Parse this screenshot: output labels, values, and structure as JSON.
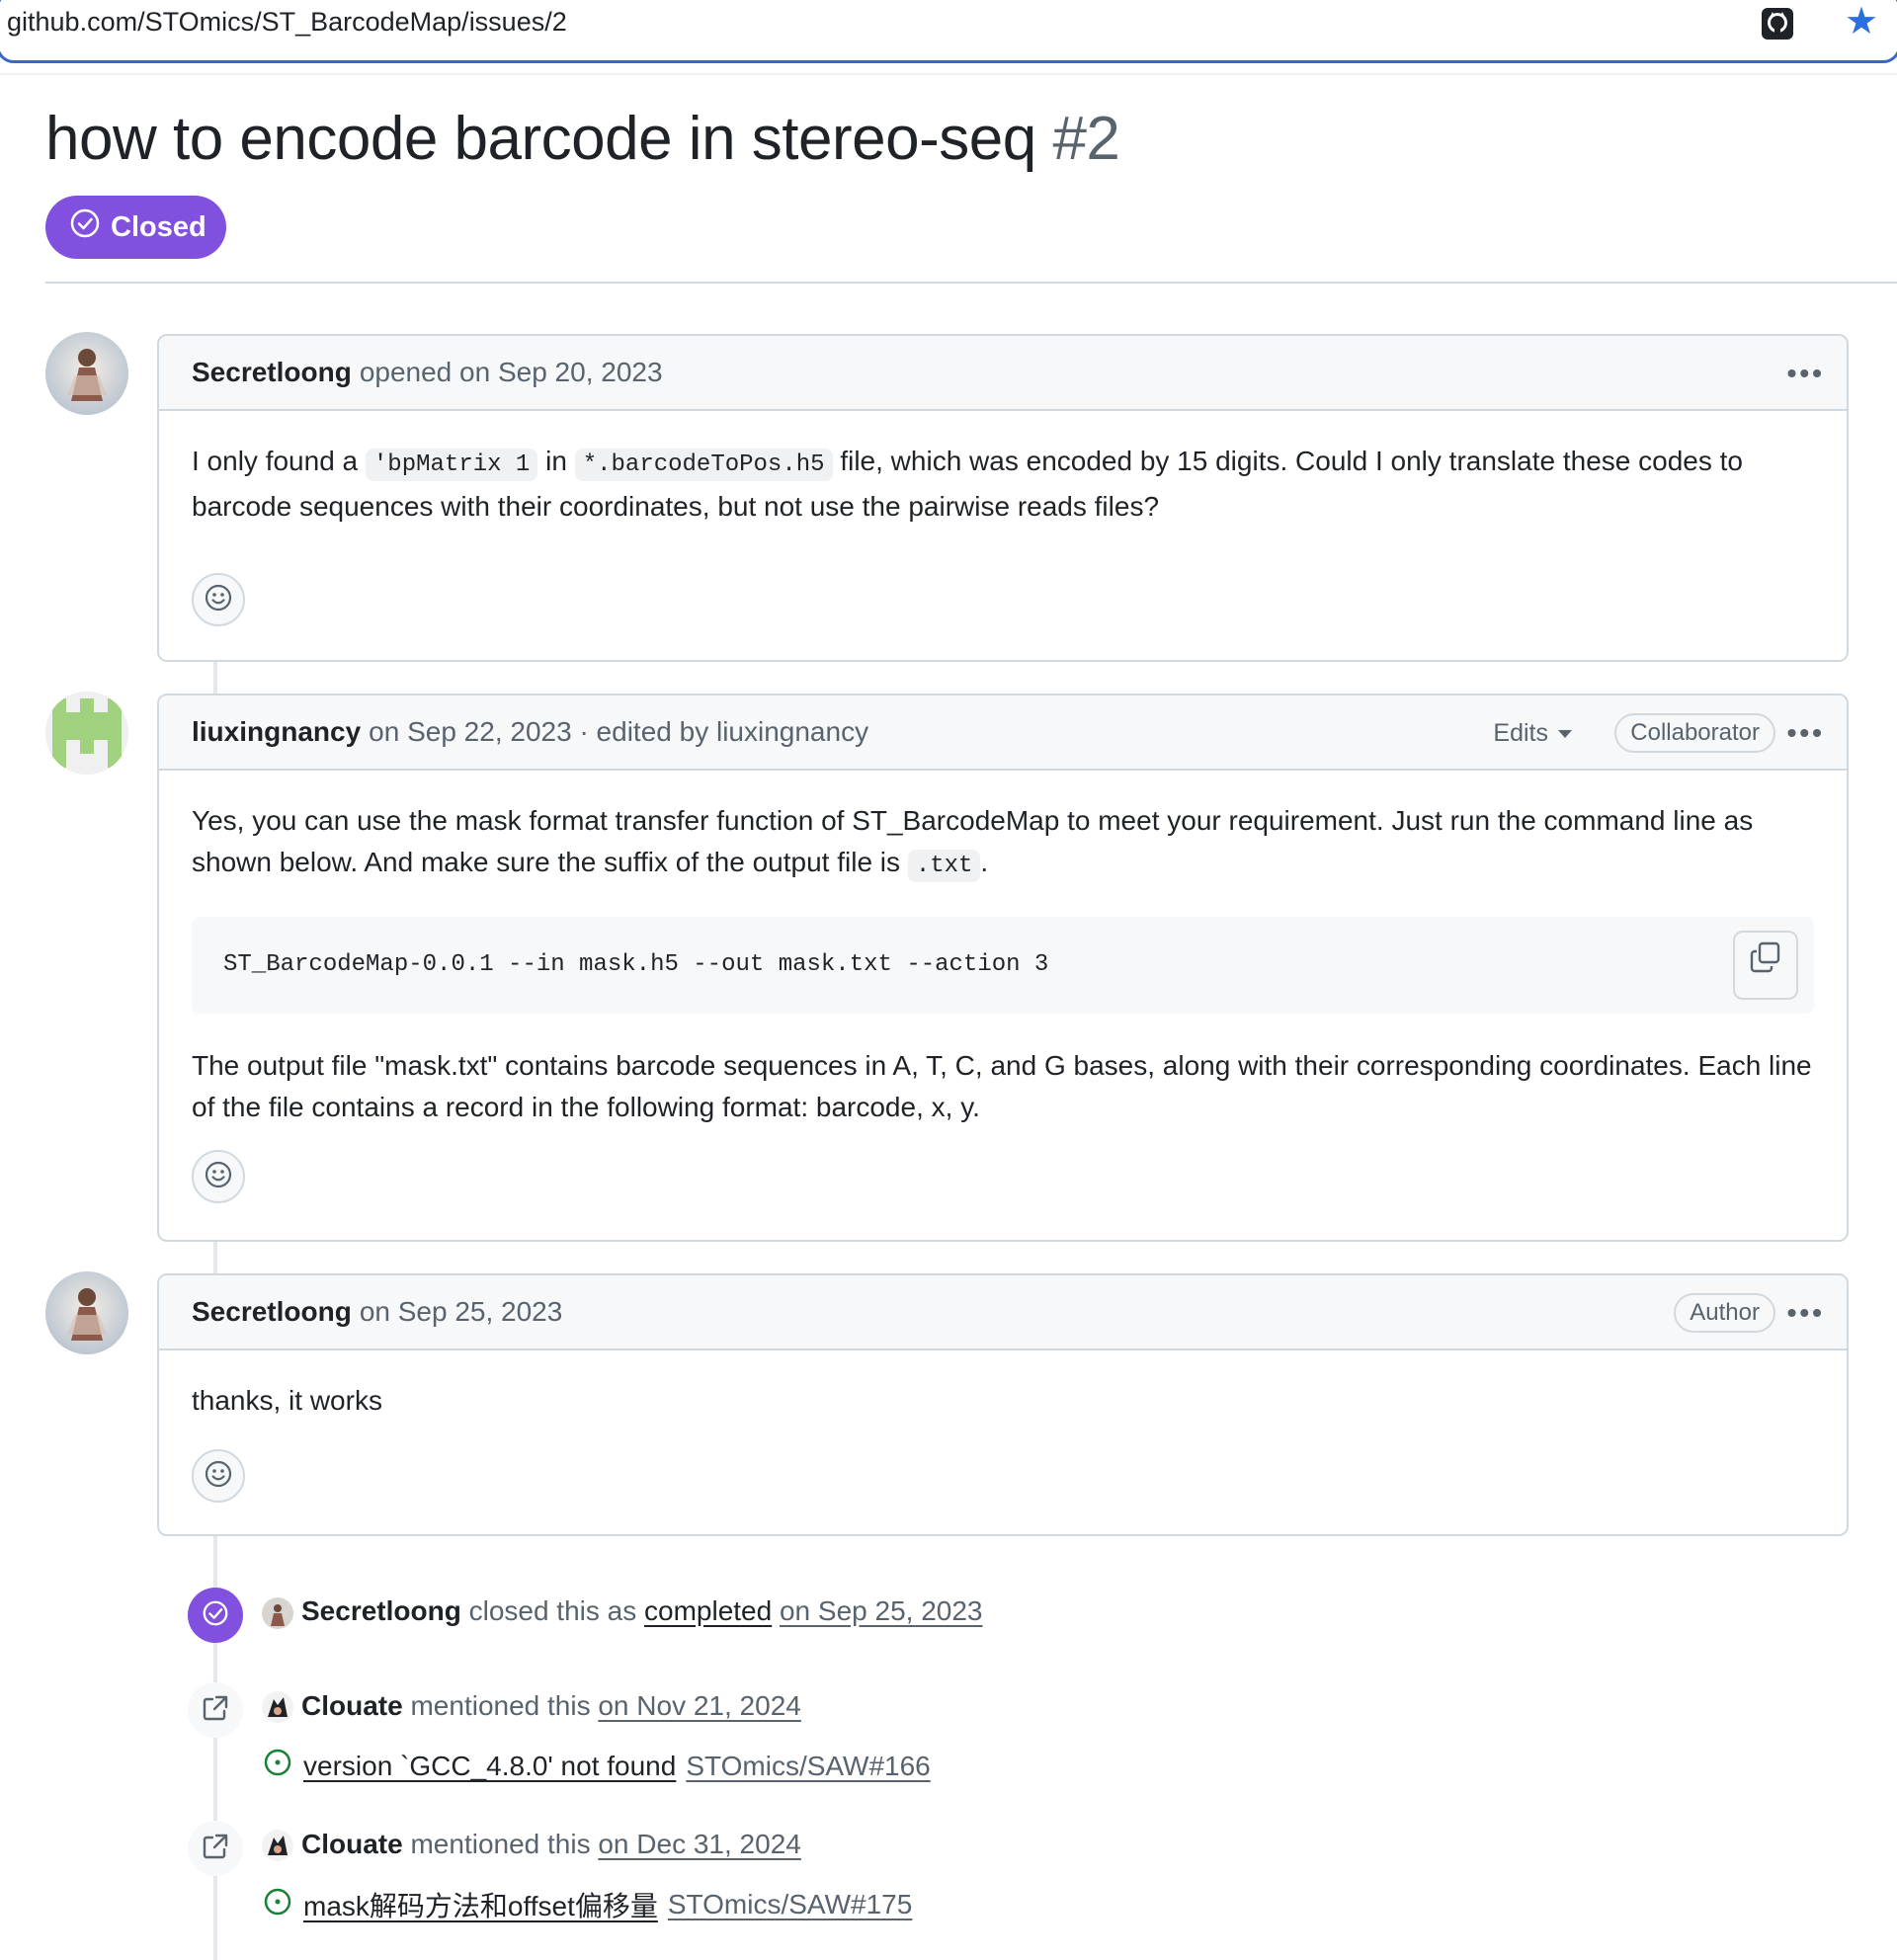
{
  "browser": {
    "url": "github.com/STOmics/ST_BarcodeMap/issues/2",
    "github_icon": "github-icon",
    "bookmark_icon": "star-icon"
  },
  "issue": {
    "title": "how to encode barcode in stereo-seq",
    "number": "#2",
    "status": "Closed",
    "status_color": "#8250df"
  },
  "comments": [
    {
      "author": "Secretloong",
      "meta": "opened on Sep 20, 2023",
      "body": {
        "t1": "I only found a ",
        "c1": "'bpMatrix 1",
        "t2": " in ",
        "c2": "*.barcodeToPos.h5",
        "t3": " file, which was encoded by 15 digits. Could I only translate these codes to barcode sequences with their coordinates, but not use the pairwise reads files?"
      }
    },
    {
      "author": "liuxingnancy",
      "meta": "on Sep 22, 2023 · edited by liuxingnancy",
      "edits_label": "Edits",
      "role": "Collaborator",
      "body": {
        "p1": "Yes, you can use the mask format transfer function of ST_BarcodeMap to meet your requirement. Just run the command line as shown below. And make sure the suffix of the output file is ",
        "p1_code": ".txt",
        "p1_end": ".",
        "code": "ST_BarcodeMap-0.0.1 --in mask.h5 --out mask.txt --action 3",
        "p2": "The output file \"mask.txt\" contains barcode sequences in A, T, C, and G bases, along with their corresponding coordinates. Each line of the file contains a record in the following format: barcode, x, y."
      }
    },
    {
      "author": "Secretloong",
      "meta": "on Sep 25, 2023",
      "role": "Author",
      "body": "thanks, it works"
    }
  ],
  "events": [
    {
      "type": "closed",
      "actor": "Secretloong",
      "text": "closed this as",
      "link": "completed",
      "date": "on Sep 25, 2023"
    },
    {
      "type": "mentioned",
      "actor": "Clouate",
      "text": "mentioned this",
      "date": "on Nov 21, 2024",
      "ref_title": "version `GCC_4.8.0' not found",
      "ref_repo": "STOmics/SAW#166"
    },
    {
      "type": "mentioned",
      "actor": "Clouate",
      "text": "mentioned this",
      "date": "on Dec 31, 2024",
      "ref_title": "mask解码方法和offset偏移量",
      "ref_repo": "STOmics/SAW#175"
    }
  ]
}
